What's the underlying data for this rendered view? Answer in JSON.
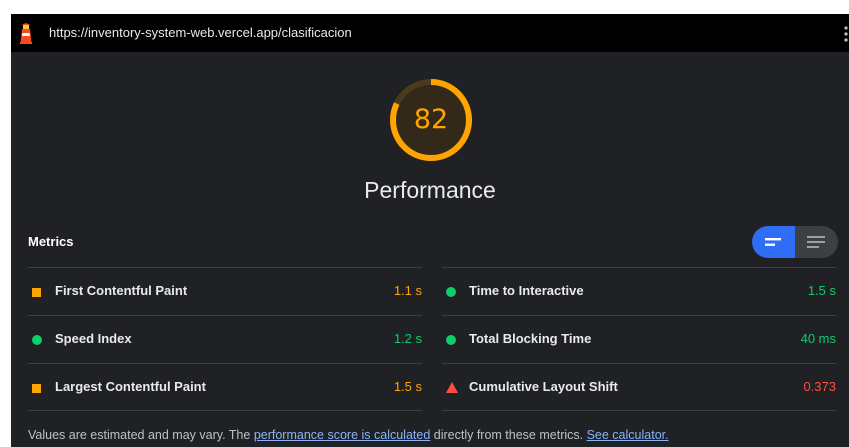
{
  "urlbar": {
    "url": "https://inventory-system-web.vercel.app/clasificacion"
  },
  "gauge": {
    "score": "82",
    "score_fraction": 0.82,
    "title": "Performance",
    "color": "#ffa400"
  },
  "metrics": {
    "title": "Metrics",
    "left": [
      {
        "label": "First Contentful Paint",
        "value": "1.1 s",
        "status": "average",
        "shape": "square",
        "color": "#ffa400"
      },
      {
        "label": "Speed Index",
        "value": "1.2 s",
        "status": "pass",
        "shape": "circle",
        "color": "#0cce6b"
      },
      {
        "label": "Largest Contentful Paint",
        "value": "1.5 s",
        "status": "average",
        "shape": "square",
        "color": "#ffa400"
      }
    ],
    "right": [
      {
        "label": "Time to Interactive",
        "value": "1.5 s",
        "status": "pass",
        "shape": "circle",
        "color": "#0cce6b"
      },
      {
        "label": "Total Blocking Time",
        "value": "40 ms",
        "status": "pass",
        "shape": "circle",
        "color": "#0cce6b"
      },
      {
        "label": "Cumulative Layout Shift",
        "value": "0.373",
        "status": "fail",
        "shape": "triangle",
        "color": "#ff4e42"
      }
    ],
    "toggle": {
      "left_icon": "compact-list-icon",
      "right_icon": "expanded-list-icon",
      "active": "left"
    }
  },
  "footer": {
    "text_before": "Values are estimated and may vary. The ",
    "link1": "performance score is calculated",
    "text_middle": " directly from these metrics. ",
    "link2": "See calculator."
  }
}
